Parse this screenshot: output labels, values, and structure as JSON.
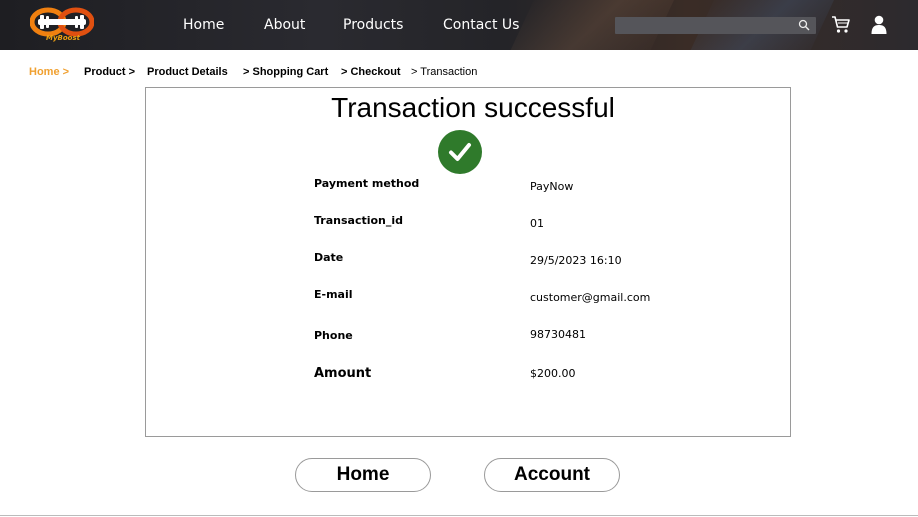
{
  "header": {
    "logo_text": "MyBoost",
    "nav": [
      "Home",
      "About",
      "Products",
      "Contact Us"
    ],
    "search_placeholder": ""
  },
  "breadcrumb": {
    "items": [
      "Home >",
      "Product >",
      "Product Details",
      "> Shopping Cart",
      "> Checkout",
      "> Transaction"
    ]
  },
  "main": {
    "title": "Transaction successful",
    "rows": [
      {
        "label": "Payment method",
        "value": "PayNow"
      },
      {
        "label": "Transaction_id",
        "value": "01"
      },
      {
        "label": "Date",
        "value": "29/5/2023 16:10"
      },
      {
        "label": "E-mail",
        "value": "customer@gmail.com"
      },
      {
        "label": "Phone",
        "value": "98730481"
      },
      {
        "label": "Amount",
        "value": "$200.00"
      }
    ]
  },
  "buttons": {
    "home": "Home",
    "account": "Account"
  },
  "colors": {
    "accent": "#f0a030",
    "success": "#2f7a2b",
    "header_bg": "#242428"
  },
  "icons": [
    "logo-icon",
    "search-icon",
    "cart-icon",
    "user-icon",
    "check-icon"
  ]
}
